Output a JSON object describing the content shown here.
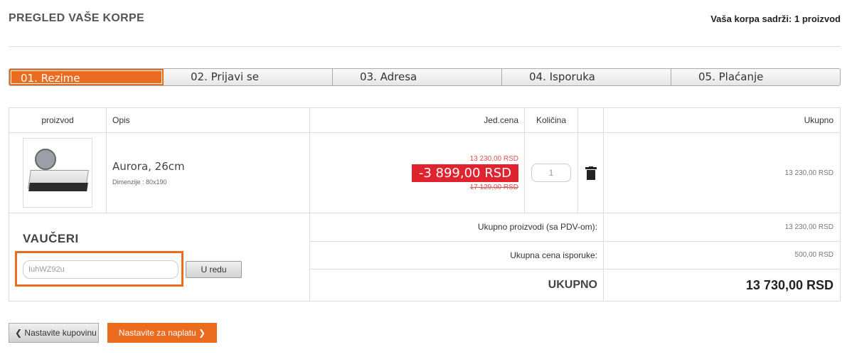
{
  "header": {
    "title": "PREGLED VAŠE KORPE",
    "cart_count": "Vaša korpa sadrži: 1 proizvod"
  },
  "steps": [
    {
      "label": "01. Rezime",
      "active": true
    },
    {
      "label": "02. Prijavi se",
      "active": false
    },
    {
      "label": "03. Adresa",
      "active": false
    },
    {
      "label": "04. Isporuka",
      "active": false
    },
    {
      "label": "05. Plaćanje",
      "active": false
    }
  ],
  "table": {
    "headers": {
      "product": "proizvod",
      "description": "Opis",
      "unit_price": "Jed.cena",
      "quantity": "Količina",
      "total": "Ukupno"
    },
    "item": {
      "name": "Aurora, 26cm",
      "dimensions": "Dimenzije : 80x190",
      "price_current": "13 230,00 RSD",
      "discount": "-3 899,00 RSD",
      "price_original": "17 129,00 RSD",
      "quantity": "1",
      "line_total": "13 230,00 RSD",
      "icons": {
        "thumbnail": "mattress-image",
        "delete": "trash-icon"
      }
    }
  },
  "vouchers": {
    "title": "VAUČERI",
    "input_value": "IuhWZ92u",
    "button_label": "U redu"
  },
  "summary": {
    "products_label": "Ukupno proizvodi (sa PDV-om):",
    "products_value": "13 230,00 RSD",
    "shipping_label": "Ukupna cena isporuke:",
    "shipping_value": "500,00 RSD",
    "total_label": "UKUPNO",
    "total_value": "13 730,00 RSD"
  },
  "footer": {
    "continue_shopping": "Nastavite kupovinu",
    "checkout": "Nastavite za naplatu"
  },
  "colors": {
    "accent": "#eb6b1f",
    "discount": "#e0232e"
  }
}
